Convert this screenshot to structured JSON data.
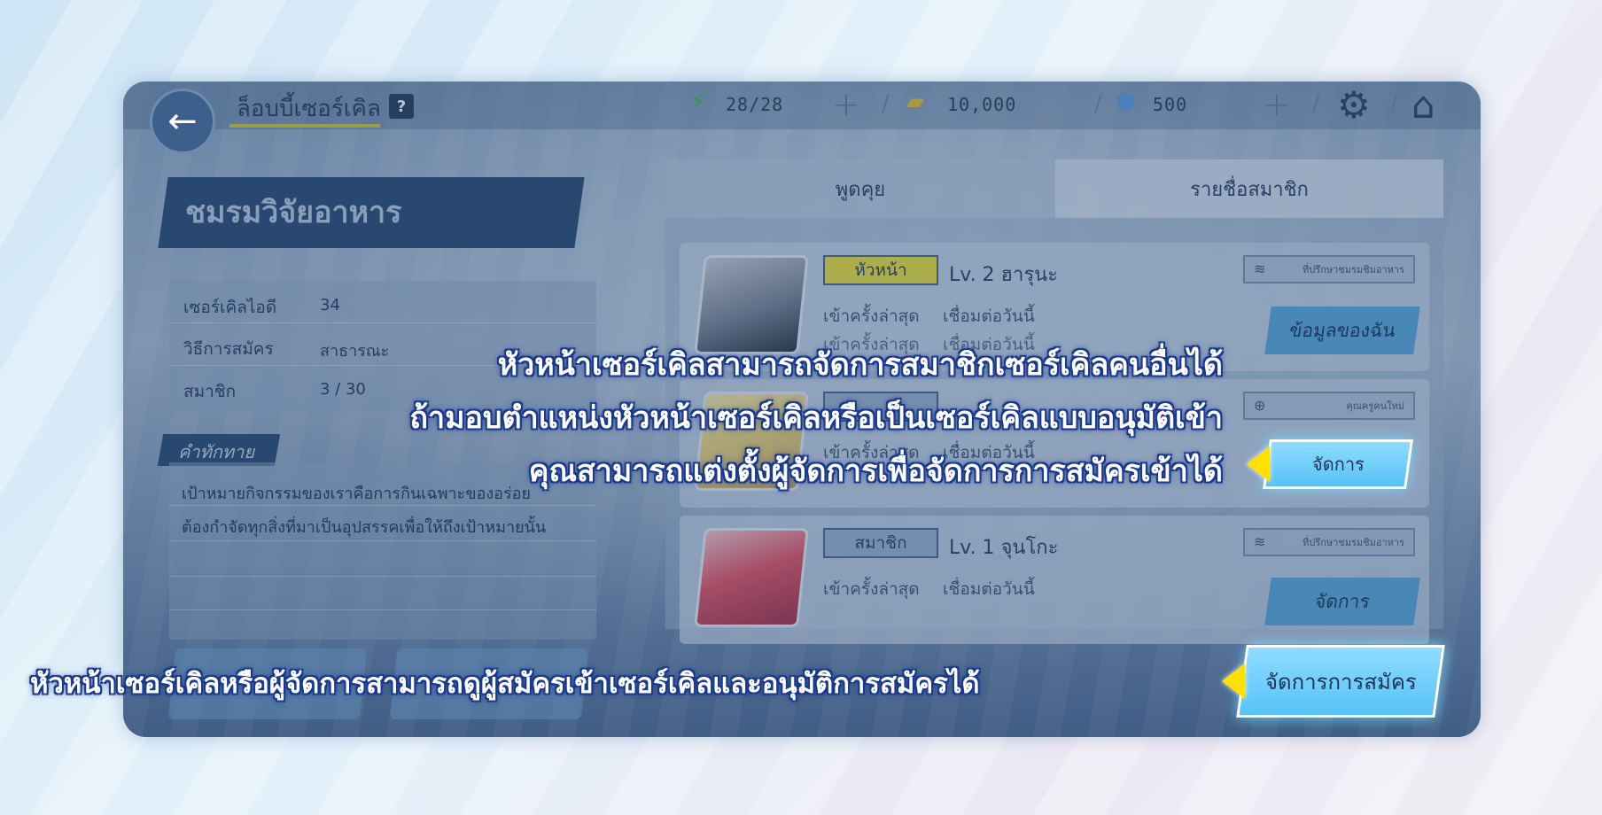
{
  "topbar": {
    "back_icon": "←",
    "title": "ล็อบบี้เซอร์เคิล",
    "help_icon": "?",
    "energy": "28/28",
    "coins": "10,000",
    "gems": "500"
  },
  "circle": {
    "name": "ชมรมวิจัยอาหาร",
    "info": [
      {
        "label": "เซอร์เคิลไอดี",
        "value": "34"
      },
      {
        "label": "วิธีการสมัคร",
        "value": "สาธารณะ"
      },
      {
        "label": "สมาชิก",
        "value": "3 / 30"
      }
    ],
    "greeting_label": "คำทักทาย",
    "greeting_lines": [
      "เป้าหมายกิจกรรมของเราคือการกินเฉพาะของอร่อย",
      "ต้องกำจัดทุกสิ่งที่มาเป็นอุปสรรคเพื่อให้ถึงเป้าหมายนั้น"
    ]
  },
  "tabs": {
    "chat": "พูดคุย",
    "members": "รายชื่อสมาชิก"
  },
  "members": [
    {
      "rank": "หัวหน้า",
      "level_text": "Lv.  2 ฮารุนะ",
      "tag": "ที่ปรึกษาชมรมชิมอาหาร",
      "login_label": "เข้าครั้งล่าสุด",
      "login_value": "เชื่อมต่อวันนี้",
      "button": "ข้อมูลของฉัน",
      "rank_color": "#e9e040"
    },
    {
      "rank": "",
      "level_text": "",
      "tag": "คุณครูคนใหม่",
      "login_label": "เข้าครั้งล่าสุด",
      "login_value": "เชื่อมต่อวันนี้",
      "button": "จัดการ",
      "rank_color": "#9bb1cf"
    },
    {
      "rank": "สมาชิก",
      "level_text": "Lv.  1 จุนโกะ",
      "tag": "ที่ปรึกษาชมรมชิมอาหาร",
      "login_label": "เข้าครั้งล่าสุด",
      "login_value": "เชื่อมต่อวันนี้",
      "button": "จัดการ",
      "rank_color": "#9bb1cf"
    }
  ],
  "highlight": {
    "manage_button": "จัดการ",
    "applications_button": "จัดการการสมัคร"
  },
  "tips": {
    "line1": "หัวหน้าเซอร์เคิลสามารถจัดการสมาชิกเซอร์เคิลคนอื่นได้",
    "line2": "ถ้ามอบตำแหน่งหัวหน้าเซอร์เคิลหรือเป็นเซอร์เคิลแบบอนุมัติเข้า",
    "line3": "คุณสามารถแต่งตั้งผู้จัดการเพื่อจัดการการสมัครเข้าได้",
    "bottom": "หัวหน้าเซอร์เคิลหรือผู้จัดการสามารถดูผู้สมัครเข้าเซอร์เคิลและอนุมัติการสมัครได้"
  },
  "colors": {
    "highlight_cyan": "#57c2f7",
    "pointer_yellow": "#ffe000",
    "tip_outline": "#1b3b8f"
  }
}
